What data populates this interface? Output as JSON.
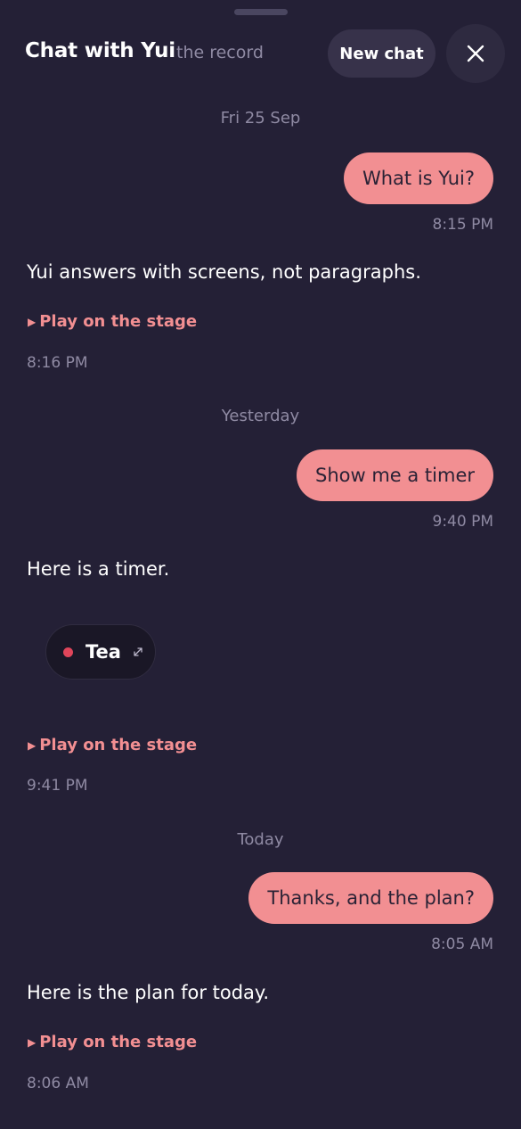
{
  "header": {
    "title": "Chat with Yui",
    "subtitle": "the record",
    "new_chat_label": "New chat",
    "close_icon": "close-icon"
  },
  "colors": {
    "background": "#242036",
    "user_bubble": "#f28f92",
    "accent": "#f28f92",
    "muted_text": "#8f8aa3",
    "timer_dot": "#e0455a"
  },
  "conversation": [
    {
      "day": "Fri 25 Sep",
      "user_message": "What is Yui?",
      "user_time": "8:15 PM",
      "assistant_message": "Yui answers with screens, not paragraphs.",
      "play_label": "Play on the stage",
      "assistant_time": "8:16 PM"
    },
    {
      "day": "Yesterday",
      "user_message": "Show me a timer",
      "user_time": "9:40 PM",
      "assistant_message": "Here is a timer.",
      "timer": {
        "label": "Tea",
        "icon": "expand-icon"
      },
      "play_label": "Play on the stage",
      "assistant_time": "9:41 PM"
    },
    {
      "day": "Today",
      "user_message": "Thanks, and the plan?",
      "user_time": "8:05 AM",
      "assistant_message": "Here is the plan for today.",
      "play_label": "Play on the stage",
      "assistant_time": "8:06 AM"
    }
  ]
}
